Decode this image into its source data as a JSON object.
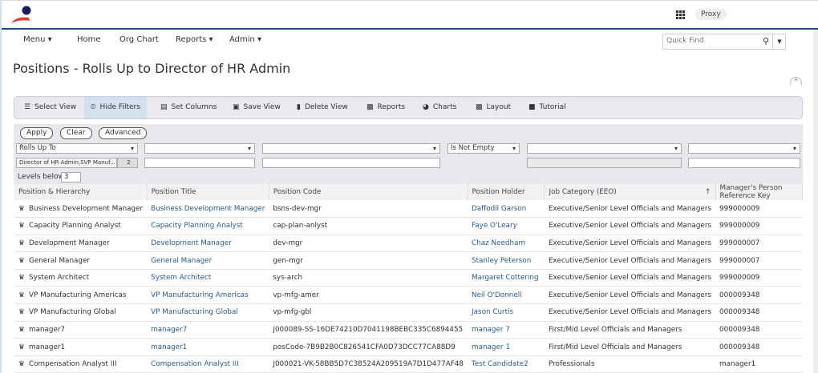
{
  "header": {
    "proxy_label": "Proxy",
    "apps_icon": "grid-icon"
  },
  "nav": {
    "items": [
      "Menu ▾",
      "Home",
      "Org Chart",
      "Reports ▾",
      "Admin ▾"
    ],
    "quick_find_placeholder": "Quick Find"
  },
  "page": {
    "title": "Positions - Rolls Up to Director of HR Admin"
  },
  "toolbar": [
    "Select View",
    "Hide Filters",
    "Set Columns",
    "Save View",
    "Delete View",
    "Reports",
    "Charts",
    "Layout",
    "Tutorial"
  ],
  "filters": {
    "apply": "Apply",
    "clear": "Clear",
    "advanced": "Advanced",
    "col1_operator": "Rolls Up To",
    "col1_value": "Director of HR Admin,SVP Manuf...",
    "col1_count": "2",
    "col4_operator": "Is Not Empty",
    "levels_label": "Levels below",
    "levels_value": "3"
  },
  "table": {
    "columns": [
      "Position & Hierarchy",
      "Position Title",
      "Position Code",
      "Position Holder",
      "Job Category (EEO)",
      "Manager's Person Reference Key"
    ],
    "sort_indicator": "↑",
    "rows": [
      [
        "Business Development Manager",
        "Business Development Manager",
        "bsns-dev-mgr",
        "Daffodil Garson",
        "Executive/Senior Level Officials and Managers",
        "999000009"
      ],
      [
        "Capacity Planning Analyst",
        "Capacity Planning Analyst",
        "cap-plan-anlyst",
        "Faye O'Leary",
        "Executive/Senior Level Officials and Managers",
        "999000009"
      ],
      [
        "Development Manager",
        "Development Manager",
        "dev-mgr",
        "Chaz Needham",
        "Executive/Senior Level Officials and Managers",
        "999000007"
      ],
      [
        "General Manager",
        "General Manager",
        "gen-mgr",
        "Stanley Peterson",
        "Executive/Senior Level Officials and Managers",
        "999000007"
      ],
      [
        "System Architect",
        "System Architect",
        "sys-arch",
        "Margaret Cottering",
        "Executive/Senior Level Officials and Managers",
        "999000009"
      ],
      [
        "VP Manufacturing Americas",
        "VP Manufacturing Americas",
        "vp-mfg-amer",
        "Neil O'Donnell",
        "Executive/Senior Level Officials and Managers",
        "000009348"
      ],
      [
        "VP Manufacturing Global",
        "VP Manufacturing Global",
        "vp-mfg-gbl",
        "Jason Curtis",
        "Executive/Senior Level Officials and Managers",
        "000009348"
      ],
      [
        "manager7",
        "manager7",
        "J000089-SS-16DE74210D7041198BEBC335C6894455",
        "manager 7",
        "First/Mid Level Officials and Managers",
        "000009348"
      ],
      [
        "manager1",
        "manager1",
        "posCode-7B9B2B0C826541CFA0D73DCC77CA88D9",
        "manager 1",
        "First/Mid Level Officials and Managers",
        "000009348"
      ],
      [
        "Compensation Analyst III",
        "Compensation Analyst III",
        "J000021-VK-58BB5D7C38524A209519A7D1D477AF48",
        "Test Candidate2",
        "Professionals",
        "manager1"
      ]
    ]
  }
}
